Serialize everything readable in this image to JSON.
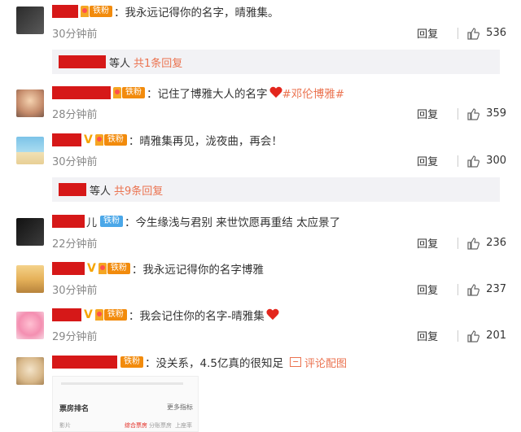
{
  "comments": [
    {
      "name_tail": "",
      "badge": "铁粉",
      "text": "：我永远记得你的名字，晴雅集。",
      "time": "30分钟前",
      "reply_label": "回复",
      "likes": "536"
    },
    {
      "name_tail": "",
      "badge": "铁粉",
      "text": "：记住了博雅大人的名字",
      "tag": "#邓伦博雅#",
      "time": "28分钟前",
      "reply_label": "回复",
      "likes": "359"
    },
    {
      "name_tail": "",
      "badge": "铁粉",
      "text": "：晴雅集再见，泷夜曲，再会！",
      "time": "30分钟前",
      "reply_label": "回复",
      "likes": "300"
    },
    {
      "name_tail": "儿",
      "badge": "铁粉",
      "text": "：今生缘浅与君别  来世饮愿再重结  太应景了",
      "time": "22分钟前",
      "reply_label": "回复",
      "likes": "236"
    },
    {
      "name_tail": "",
      "badge": "铁粉",
      "text": "：我永远记得你的名字博雅",
      "time": "30分钟前",
      "reply_label": "回复",
      "likes": "237"
    },
    {
      "name_tail": "",
      "badge": "铁粉",
      "text": "：我会记住你的名字-晴雅集",
      "time": "29分钟前",
      "reply_label": "回复",
      "likes": "201"
    },
    {
      "name_tail": "",
      "badge": "铁粉",
      "text": "：没关系，4.5亿真的很知足",
      "pic_link": "评论配图"
    }
  ],
  "subreplies": [
    {
      "prefix": "等人",
      "more": "共1条回复"
    },
    {
      "prefix": "等人",
      "more": "共9条回复"
    }
  ],
  "thumbnail": {
    "header_left": "票房排名",
    "header_right": "更多指标",
    "col_1": "影片",
    "col_2": "综合票房",
    "col_3": "分账票房",
    "col_4": "上座率"
  },
  "colors": {
    "accent": "#eb7350",
    "redaction": "#d61818",
    "badge_orange": "#f28b0c",
    "badge_blue": "#4aa7e8",
    "subreply_bg": "#f2f2f5"
  }
}
